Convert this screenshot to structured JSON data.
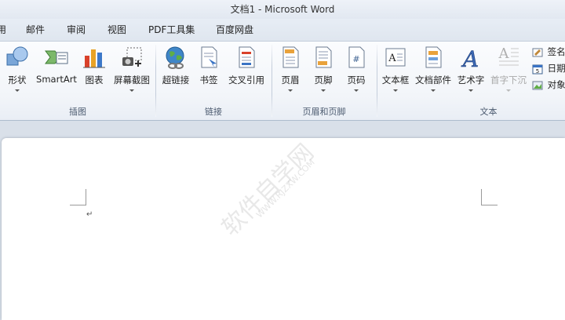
{
  "window": {
    "title": "文档1  -  Microsoft Word"
  },
  "menu_tabs": [
    "用",
    "邮件",
    "审阅",
    "视图",
    "PDF工具集",
    "百度网盘"
  ],
  "groups": {
    "illustrations": {
      "label": "插图",
      "buttons": [
        "形状",
        "SmartArt",
        "图表",
        "屏幕截图"
      ]
    },
    "links": {
      "label": "链接",
      "buttons": [
        "超链接",
        "书签",
        "交叉引用"
      ]
    },
    "header_footer": {
      "label": "页眉和页脚",
      "buttons": [
        "页眉",
        "页脚",
        "页码"
      ]
    },
    "text": {
      "label": "文本",
      "buttons": [
        "文本框",
        "文档部件",
        "艺术字",
        "首字下沉"
      ],
      "small_buttons": [
        "签名",
        "日期",
        "对象"
      ]
    }
  },
  "document": {
    "paragraph_mark": "↵"
  },
  "watermark": {
    "text": "软件自学网",
    "url": "WWW.RJZXW.COM"
  },
  "colors": {
    "ribbon_bg": "#f2f5f9",
    "page": "#ffffff",
    "doc_bg": "#d9e0e9"
  }
}
